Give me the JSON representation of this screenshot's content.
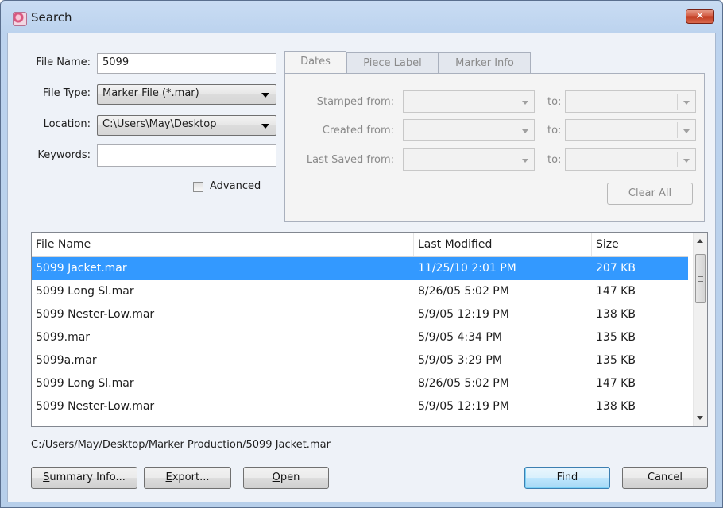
{
  "window": {
    "title": "Search",
    "close_label": "✕"
  },
  "form": {
    "file_name_label": "File Name:",
    "file_name_value": "5099",
    "file_type_label": "File Type:",
    "file_type_value": "Marker File (*.mar)",
    "location_label": "Location:",
    "location_value": "C:\\Users\\May\\Desktop",
    "keywords_label": "Keywords:",
    "keywords_value": "",
    "advanced_label": "Advanced",
    "advanced_checked": false
  },
  "tabs": [
    "Dates",
    "Piece Label",
    "Marker Info"
  ],
  "dates": {
    "stamped_label": "Stamped from:",
    "created_label": "Created from:",
    "last_saved_label": "Last Saved from:",
    "to_label": "to:",
    "clear_all_label": "Clear All"
  },
  "table": {
    "columns": [
      "File Name",
      "Last Modified",
      "Size"
    ],
    "rows": [
      {
        "name": "5099 Jacket.mar",
        "modified": "11/25/10 2:01 PM",
        "size": "207 KB",
        "selected": true
      },
      {
        "name": "5099 Long Sl.mar",
        "modified": "8/26/05 5:02 PM",
        "size": "147 KB"
      },
      {
        "name": "5099 Nester-Low.mar",
        "modified": "5/9/05 12:19 PM",
        "size": "138 KB"
      },
      {
        "name": "5099.mar",
        "modified": "5/9/05 4:34 PM",
        "size": "135 KB"
      },
      {
        "name": "5099a.mar",
        "modified": "5/9/05 3:29 PM",
        "size": "135 KB"
      },
      {
        "name": "5099 Long Sl.mar",
        "modified": "8/26/05 5:02 PM",
        "size": "147 KB"
      },
      {
        "name": "5099 Nester-Low.mar",
        "modified": "5/9/05 12:19 PM",
        "size": "138 KB"
      }
    ]
  },
  "selected_path": "C:/Users/May/Desktop/Marker Production/5099 Jacket.mar",
  "buttons": {
    "summary_first": "S",
    "summary_rest": "ummary Info...",
    "export_first": "E",
    "export_rest": "xport...",
    "open_first": "O",
    "open_rest": "pen",
    "find": "Find",
    "cancel": "Cancel"
  },
  "colors": {
    "selection": "#3399ff",
    "title_bar": "#c9dcf3"
  }
}
